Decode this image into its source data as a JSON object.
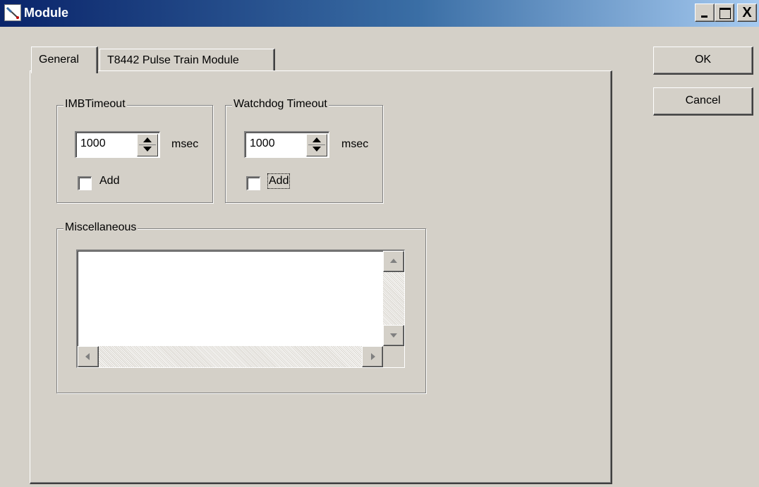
{
  "window": {
    "title": "Module",
    "title_gradient": [
      "#0a246a",
      "#a6caf0"
    ],
    "face_color": "#d4d0c8"
  },
  "title_buttons": {
    "minimize_icon": "minimize-icon",
    "maximize_icon": "maximize-icon",
    "close_glyph": "X"
  },
  "tabs": [
    {
      "label": "General",
      "selected": true
    },
    {
      "label": "T8442 Pulse Train Module",
      "selected": false
    }
  ],
  "imb_timeout": {
    "group_label": "IMBTimeout",
    "value": "1000",
    "unit": "msec",
    "checkbox_label": "Add",
    "checked": false
  },
  "watchdog_timeout": {
    "group_label": "Watchdog Timeout",
    "value": "1000",
    "unit": "msec",
    "checkbox_label": "Add",
    "checked": false,
    "focused": true
  },
  "miscellaneous": {
    "group_label": "Miscellaneous",
    "text": ""
  },
  "buttons": {
    "ok_label": "OK",
    "cancel_label": "Cancel"
  }
}
